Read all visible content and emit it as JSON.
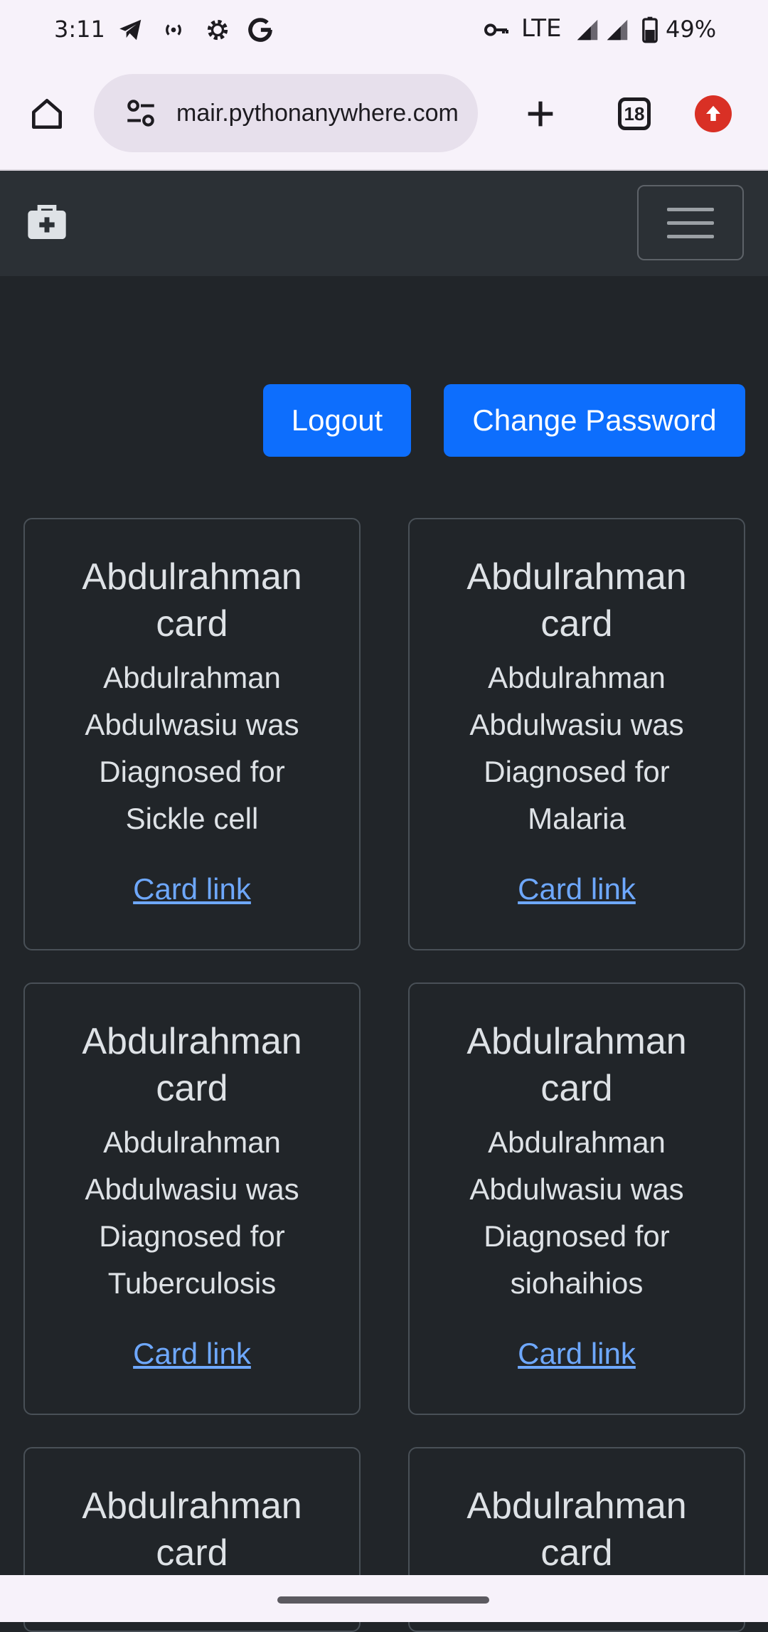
{
  "status_bar": {
    "time": "3:11",
    "network": "LTE",
    "battery": "49%",
    "icons": [
      "telegram-icon",
      "hotspot-icon",
      "settings-icon",
      "google-icon",
      "vpn-key-icon",
      "signal-icon",
      "signal-icon",
      "battery-icon"
    ]
  },
  "browser": {
    "url": "mair.pythonanywhere.com",
    "tab_count": "18",
    "icons": [
      "home-icon",
      "site-settings-icon",
      "new-tab-icon",
      "tab-switcher-icon",
      "update-icon"
    ]
  },
  "navbar": {
    "brand_icon": "medical-briefcase-icon",
    "toggler_icon": "hamburger-icon"
  },
  "actions": {
    "logout": "Logout",
    "change_password": "Change Password"
  },
  "cards": [
    {
      "title_line1": "Abdulrahman",
      "title_line2": "card",
      "text_lines": [
        "Abdulrahman",
        "Abdulwasiu was",
        "Diagnosed for",
        "Sickle cell"
      ],
      "link": "Card link"
    },
    {
      "title_line1": "Abdulrahman",
      "title_line2": "card",
      "text_lines": [
        "Abdulrahman",
        "Abdulwasiu was",
        "Diagnosed for",
        "Malaria"
      ],
      "link": "Card link"
    },
    {
      "title_line1": "Abdulrahman",
      "title_line2": "card",
      "text_lines": [
        "Abdulrahman",
        "Abdulwasiu was",
        "Diagnosed for",
        "Tuberculosis"
      ],
      "link": "Card link"
    },
    {
      "title_line1": "Abdulrahman",
      "title_line2": "card",
      "text_lines": [
        "Abdulrahman",
        "Abdulwasiu was",
        "Diagnosed for",
        "siohaihios"
      ],
      "link": "Card link"
    },
    {
      "title_line1": "Abdulrahman",
      "title_line2": "card"
    },
    {
      "title_line1": "Abdulrahman",
      "title_line2": "card"
    }
  ],
  "colors": {
    "page_bg": "#212529",
    "navbar_bg": "#2b3035",
    "primary": "#0d6efd",
    "link": "#6ea8fe",
    "card_border": "#495057"
  }
}
